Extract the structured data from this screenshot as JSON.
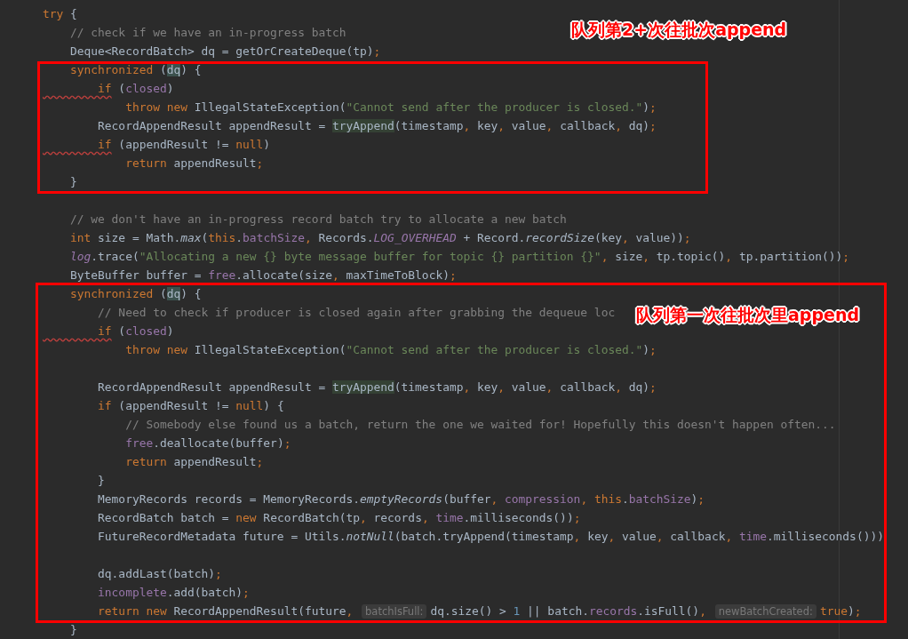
{
  "editor": {
    "lines": [
      {
        "kind": "code",
        "tokens": [
          {
            "kind": "k",
            "text": "try"
          },
          {
            "kind": "t",
            "text": " {"
          }
        ]
      },
      {
        "kind": "code",
        "tokens": [
          {
            "kind": "c",
            "text": "    // check if we have an in-progress batch"
          }
        ]
      },
      {
        "kind": "code",
        "tokens": [
          {
            "kind": "t",
            "text": "    Deque<RecordBatch> dq = getOrCreateDeque(tp)"
          },
          {
            "kind": "p",
            "text": ";"
          }
        ]
      },
      {
        "kind": "code",
        "tokens": [
          {
            "kind": "k",
            "text": "    synchronized"
          },
          {
            "kind": "t",
            "text": " ("
          },
          {
            "kind": "m",
            "text": "dq"
          },
          {
            "kind": "t",
            "text": ") {"
          }
        ]
      },
      {
        "kind": "code",
        "tokens": [
          {
            "kind": "w",
            "text": "        if"
          },
          {
            "kind": "t",
            "text": " ("
          },
          {
            "kind": "f",
            "text": "closed"
          },
          {
            "kind": "t",
            "text": ")"
          }
        ]
      },
      {
        "kind": "code",
        "tokens": [
          {
            "kind": "k",
            "text": "            throw new"
          },
          {
            "kind": "t",
            "text": " IllegalStateException("
          },
          {
            "kind": "s",
            "text": "\"Cannot send after the producer is closed.\""
          },
          {
            "kind": "t",
            "text": ")"
          },
          {
            "kind": "p",
            "text": ";"
          }
        ]
      },
      {
        "kind": "code",
        "tokens": [
          {
            "kind": "t",
            "text": "        RecordAppendResult appendResult = "
          },
          {
            "kind": "u",
            "text": "tryAppend"
          },
          {
            "kind": "t",
            "text": "(timestamp"
          },
          {
            "kind": "p",
            "text": ", "
          },
          {
            "kind": "t",
            "text": "key"
          },
          {
            "kind": "p",
            "text": ", "
          },
          {
            "kind": "t",
            "text": "value"
          },
          {
            "kind": "p",
            "text": ", "
          },
          {
            "kind": "t",
            "text": "callback"
          },
          {
            "kind": "p",
            "text": ", "
          },
          {
            "kind": "t",
            "text": "dq)"
          },
          {
            "kind": "p",
            "text": ";"
          }
        ]
      },
      {
        "kind": "code",
        "tokens": [
          {
            "kind": "w",
            "text": "        if"
          },
          {
            "kind": "t",
            "text": " (appendResult != "
          },
          {
            "kind": "k",
            "text": "null"
          },
          {
            "kind": "t",
            "text": ")"
          }
        ]
      },
      {
        "kind": "code",
        "tokens": [
          {
            "kind": "k",
            "text": "            return"
          },
          {
            "kind": "t",
            "text": " appendResult"
          },
          {
            "kind": "p",
            "text": ";"
          }
        ]
      },
      {
        "kind": "code",
        "tokens": [
          {
            "kind": "t",
            "text": "    }"
          }
        ]
      },
      {
        "kind": "blank"
      },
      {
        "kind": "code",
        "tokens": [
          {
            "kind": "c",
            "text": "    // we don't have an in-progress record batch try to allocate a new batch"
          }
        ]
      },
      {
        "kind": "code",
        "tokens": [
          {
            "kind": "k",
            "text": "    int"
          },
          {
            "kind": "t",
            "text": " size = Math."
          },
          {
            "kind": "i",
            "text": "max"
          },
          {
            "kind": "t",
            "text": "("
          },
          {
            "kind": "k",
            "text": "this"
          },
          {
            "kind": "t",
            "text": "."
          },
          {
            "kind": "f",
            "text": "batchSize"
          },
          {
            "kind": "p",
            "text": ", "
          },
          {
            "kind": "t",
            "text": "Records."
          },
          {
            "kind": "fi",
            "text": "LOG_OVERHEAD"
          },
          {
            "kind": "t",
            "text": " + Record."
          },
          {
            "kind": "i",
            "text": "recordSize"
          },
          {
            "kind": "t",
            "text": "(key"
          },
          {
            "kind": "p",
            "text": ", "
          },
          {
            "kind": "t",
            "text": "value))"
          },
          {
            "kind": "p",
            "text": ";"
          }
        ]
      },
      {
        "kind": "code",
        "tokens": [
          {
            "kind": "fi",
            "text": "    log"
          },
          {
            "kind": "t",
            "text": ".trace("
          },
          {
            "kind": "s",
            "text": "\"Allocating a new {} byte message buffer for topic {} partition {}\""
          },
          {
            "kind": "p",
            "text": ", "
          },
          {
            "kind": "t",
            "text": "size"
          },
          {
            "kind": "p",
            "text": ", "
          },
          {
            "kind": "t",
            "text": "tp.topic()"
          },
          {
            "kind": "p",
            "text": ", "
          },
          {
            "kind": "t",
            "text": "tp.partition())"
          },
          {
            "kind": "p",
            "text": ";"
          }
        ]
      },
      {
        "kind": "code",
        "tokens": [
          {
            "kind": "t",
            "text": "    ByteBuffer buffer = "
          },
          {
            "kind": "f",
            "text": "free"
          },
          {
            "kind": "t",
            "text": ".allocate(size"
          },
          {
            "kind": "p",
            "text": ", "
          },
          {
            "kind": "t",
            "text": "maxTimeToBlock)"
          },
          {
            "kind": "p",
            "text": ";"
          }
        ]
      },
      {
        "kind": "code",
        "tokens": [
          {
            "kind": "k",
            "text": "    synchronized"
          },
          {
            "kind": "t",
            "text": " ("
          },
          {
            "kind": "m",
            "text": "dq"
          },
          {
            "kind": "t",
            "text": ") {"
          }
        ]
      },
      {
        "kind": "code",
        "tokens": [
          {
            "kind": "c",
            "text": "        // Need to check if producer is closed again after grabbing the dequeue loc"
          }
        ]
      },
      {
        "kind": "code",
        "tokens": [
          {
            "kind": "w",
            "text": "        if"
          },
          {
            "kind": "t",
            "text": " ("
          },
          {
            "kind": "f",
            "text": "closed"
          },
          {
            "kind": "t",
            "text": ")"
          }
        ]
      },
      {
        "kind": "code",
        "tokens": [
          {
            "kind": "k",
            "text": "            throw new"
          },
          {
            "kind": "t",
            "text": " IllegalStateException("
          },
          {
            "kind": "s",
            "text": "\"Cannot send after the producer is closed.\""
          },
          {
            "kind": "t",
            "text": ")"
          },
          {
            "kind": "p",
            "text": ";"
          }
        ]
      },
      {
        "kind": "blank"
      },
      {
        "kind": "code",
        "tokens": [
          {
            "kind": "t",
            "text": "        RecordAppendResult appendResult = "
          },
          {
            "kind": "u",
            "text": "tryAppend"
          },
          {
            "kind": "t",
            "text": "(timestamp"
          },
          {
            "kind": "p",
            "text": ", "
          },
          {
            "kind": "t",
            "text": "key"
          },
          {
            "kind": "p",
            "text": ", "
          },
          {
            "kind": "t",
            "text": "value"
          },
          {
            "kind": "p",
            "text": ", "
          },
          {
            "kind": "t",
            "text": "callback"
          },
          {
            "kind": "p",
            "text": ", "
          },
          {
            "kind": "t",
            "text": "dq)"
          },
          {
            "kind": "p",
            "text": ";"
          }
        ]
      },
      {
        "kind": "code",
        "tokens": [
          {
            "kind": "k",
            "text": "        if"
          },
          {
            "kind": "t",
            "text": " (appendResult != "
          },
          {
            "kind": "k",
            "text": "null"
          },
          {
            "kind": "t",
            "text": ") {"
          }
        ]
      },
      {
        "kind": "code",
        "tokens": [
          {
            "kind": "c",
            "text": "            // Somebody else found us a batch, return the one we waited for! Hopefully this doesn't happen often..."
          }
        ]
      },
      {
        "kind": "code",
        "tokens": [
          {
            "kind": "f",
            "text": "            free"
          },
          {
            "kind": "t",
            "text": ".deallocate(buffer)"
          },
          {
            "kind": "p",
            "text": ";"
          }
        ]
      },
      {
        "kind": "code",
        "tokens": [
          {
            "kind": "k",
            "text": "            return"
          },
          {
            "kind": "t",
            "text": " appendResult"
          },
          {
            "kind": "p",
            "text": ";"
          }
        ]
      },
      {
        "kind": "code",
        "tokens": [
          {
            "kind": "t",
            "text": "        }"
          }
        ]
      },
      {
        "kind": "code",
        "tokens": [
          {
            "kind": "t",
            "text": "        MemoryRecords records = MemoryRecords."
          },
          {
            "kind": "i",
            "text": "emptyRecords"
          },
          {
            "kind": "t",
            "text": "(buffer"
          },
          {
            "kind": "p",
            "text": ", "
          },
          {
            "kind": "f",
            "text": "compression"
          },
          {
            "kind": "p",
            "text": ", "
          },
          {
            "kind": "k",
            "text": "this"
          },
          {
            "kind": "t",
            "text": "."
          },
          {
            "kind": "f",
            "text": "batchSize"
          },
          {
            "kind": "t",
            "text": ")"
          },
          {
            "kind": "p",
            "text": ";"
          }
        ]
      },
      {
        "kind": "code",
        "tokens": [
          {
            "kind": "t",
            "text": "        RecordBatch batch = "
          },
          {
            "kind": "k",
            "text": "new"
          },
          {
            "kind": "t",
            "text": " RecordBatch(tp"
          },
          {
            "kind": "p",
            "text": ", "
          },
          {
            "kind": "t",
            "text": "records"
          },
          {
            "kind": "p",
            "text": ", "
          },
          {
            "kind": "f",
            "text": "time"
          },
          {
            "kind": "t",
            "text": ".milliseconds())"
          },
          {
            "kind": "p",
            "text": ";"
          }
        ]
      },
      {
        "kind": "code",
        "tokens": [
          {
            "kind": "t",
            "text": "        FutureRecordMetadata future = Utils."
          },
          {
            "kind": "i",
            "text": "notNull"
          },
          {
            "kind": "t",
            "text": "(batch.tryAppend(timestamp"
          },
          {
            "kind": "p",
            "text": ", "
          },
          {
            "kind": "t",
            "text": "key"
          },
          {
            "kind": "p",
            "text": ", "
          },
          {
            "kind": "t",
            "text": "value"
          },
          {
            "kind": "p",
            "text": ", "
          },
          {
            "kind": "t",
            "text": "callback"
          },
          {
            "kind": "p",
            "text": ", "
          },
          {
            "kind": "f",
            "text": "time"
          },
          {
            "kind": "t",
            "text": ".milliseconds()))"
          }
        ]
      },
      {
        "kind": "blank"
      },
      {
        "kind": "code",
        "tokens": [
          {
            "kind": "t",
            "text": "        dq.addLast(batch)"
          },
          {
            "kind": "p",
            "text": ";"
          }
        ]
      },
      {
        "kind": "code",
        "tokens": [
          {
            "kind": "f",
            "text": "        incomplete"
          },
          {
            "kind": "t",
            "text": ".add(batch)"
          },
          {
            "kind": "p",
            "text": ";"
          }
        ]
      },
      {
        "kind": "code",
        "tokens": [
          {
            "kind": "k",
            "text": "        return new"
          },
          {
            "kind": "t",
            "text": " RecordAppendResult(future"
          },
          {
            "kind": "p",
            "text": ", "
          },
          {
            "kind": "h",
            "text": "batchIsFull:"
          },
          {
            "kind": "t",
            "text": "dq.size() > "
          },
          {
            "kind": "n",
            "text": "1"
          },
          {
            "kind": "t",
            "text": " || batch."
          },
          {
            "kind": "f",
            "text": "records"
          },
          {
            "kind": "t",
            "text": ".isFull()"
          },
          {
            "kind": "p",
            "text": ", "
          },
          {
            "kind": "h",
            "text": "newBatchCreated:"
          },
          {
            "kind": "k",
            "text": "true"
          },
          {
            "kind": "t",
            "text": ")"
          },
          {
            "kind": "p",
            "text": ";"
          }
        ]
      },
      {
        "kind": "code",
        "tokens": [
          {
            "kind": "t",
            "text": "    }"
          }
        ]
      }
    ]
  },
  "annotations": [
    {
      "label": "队列第2+次往批次append"
    },
    {
      "label": "队列第一次往批次里append"
    }
  ]
}
